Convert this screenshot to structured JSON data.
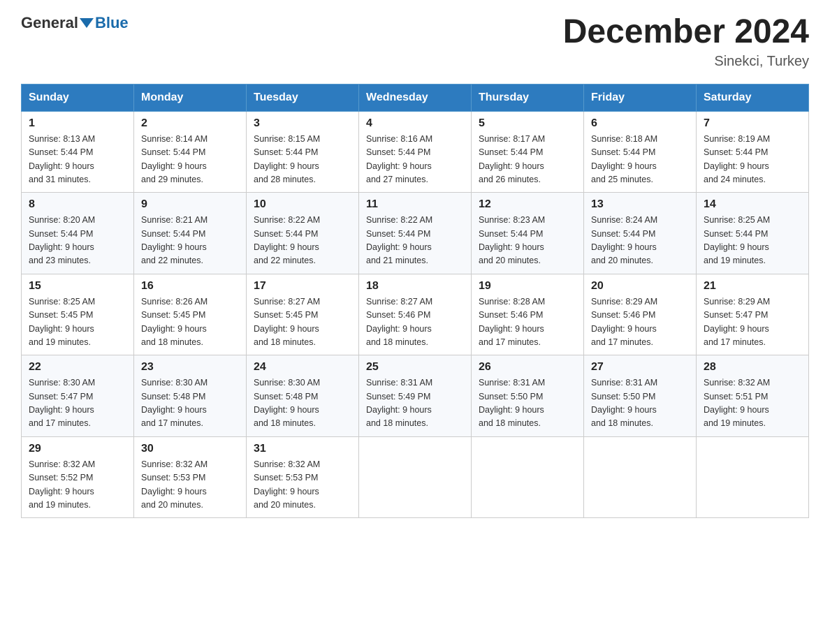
{
  "header": {
    "logo_general": "General",
    "logo_blue": "Blue",
    "month_year": "December 2024",
    "location": "Sinekci, Turkey"
  },
  "days_of_week": [
    "Sunday",
    "Monday",
    "Tuesday",
    "Wednesday",
    "Thursday",
    "Friday",
    "Saturday"
  ],
  "weeks": [
    [
      {
        "day": "1",
        "sunrise": "8:13 AM",
        "sunset": "5:44 PM",
        "daylight": "9 hours and 31 minutes."
      },
      {
        "day": "2",
        "sunrise": "8:14 AM",
        "sunset": "5:44 PM",
        "daylight": "9 hours and 29 minutes."
      },
      {
        "day": "3",
        "sunrise": "8:15 AM",
        "sunset": "5:44 PM",
        "daylight": "9 hours and 28 minutes."
      },
      {
        "day": "4",
        "sunrise": "8:16 AM",
        "sunset": "5:44 PM",
        "daylight": "9 hours and 27 minutes."
      },
      {
        "day": "5",
        "sunrise": "8:17 AM",
        "sunset": "5:44 PM",
        "daylight": "9 hours and 26 minutes."
      },
      {
        "day": "6",
        "sunrise": "8:18 AM",
        "sunset": "5:44 PM",
        "daylight": "9 hours and 25 minutes."
      },
      {
        "day": "7",
        "sunrise": "8:19 AM",
        "sunset": "5:44 PM",
        "daylight": "9 hours and 24 minutes."
      }
    ],
    [
      {
        "day": "8",
        "sunrise": "8:20 AM",
        "sunset": "5:44 PM",
        "daylight": "9 hours and 23 minutes."
      },
      {
        "day": "9",
        "sunrise": "8:21 AM",
        "sunset": "5:44 PM",
        "daylight": "9 hours and 22 minutes."
      },
      {
        "day": "10",
        "sunrise": "8:22 AM",
        "sunset": "5:44 PM",
        "daylight": "9 hours and 22 minutes."
      },
      {
        "day": "11",
        "sunrise": "8:22 AM",
        "sunset": "5:44 PM",
        "daylight": "9 hours and 21 minutes."
      },
      {
        "day": "12",
        "sunrise": "8:23 AM",
        "sunset": "5:44 PM",
        "daylight": "9 hours and 20 minutes."
      },
      {
        "day": "13",
        "sunrise": "8:24 AM",
        "sunset": "5:44 PM",
        "daylight": "9 hours and 20 minutes."
      },
      {
        "day": "14",
        "sunrise": "8:25 AM",
        "sunset": "5:44 PM",
        "daylight": "9 hours and 19 minutes."
      }
    ],
    [
      {
        "day": "15",
        "sunrise": "8:25 AM",
        "sunset": "5:45 PM",
        "daylight": "9 hours and 19 minutes."
      },
      {
        "day": "16",
        "sunrise": "8:26 AM",
        "sunset": "5:45 PM",
        "daylight": "9 hours and 18 minutes."
      },
      {
        "day": "17",
        "sunrise": "8:27 AM",
        "sunset": "5:45 PM",
        "daylight": "9 hours and 18 minutes."
      },
      {
        "day": "18",
        "sunrise": "8:27 AM",
        "sunset": "5:46 PM",
        "daylight": "9 hours and 18 minutes."
      },
      {
        "day": "19",
        "sunrise": "8:28 AM",
        "sunset": "5:46 PM",
        "daylight": "9 hours and 17 minutes."
      },
      {
        "day": "20",
        "sunrise": "8:29 AM",
        "sunset": "5:46 PM",
        "daylight": "9 hours and 17 minutes."
      },
      {
        "day": "21",
        "sunrise": "8:29 AM",
        "sunset": "5:47 PM",
        "daylight": "9 hours and 17 minutes."
      }
    ],
    [
      {
        "day": "22",
        "sunrise": "8:30 AM",
        "sunset": "5:47 PM",
        "daylight": "9 hours and 17 minutes."
      },
      {
        "day": "23",
        "sunrise": "8:30 AM",
        "sunset": "5:48 PM",
        "daylight": "9 hours and 17 minutes."
      },
      {
        "day": "24",
        "sunrise": "8:30 AM",
        "sunset": "5:48 PM",
        "daylight": "9 hours and 18 minutes."
      },
      {
        "day": "25",
        "sunrise": "8:31 AM",
        "sunset": "5:49 PM",
        "daylight": "9 hours and 18 minutes."
      },
      {
        "day": "26",
        "sunrise": "8:31 AM",
        "sunset": "5:50 PM",
        "daylight": "9 hours and 18 minutes."
      },
      {
        "day": "27",
        "sunrise": "8:31 AM",
        "sunset": "5:50 PM",
        "daylight": "9 hours and 18 minutes."
      },
      {
        "day": "28",
        "sunrise": "8:32 AM",
        "sunset": "5:51 PM",
        "daylight": "9 hours and 19 minutes."
      }
    ],
    [
      {
        "day": "29",
        "sunrise": "8:32 AM",
        "sunset": "5:52 PM",
        "daylight": "9 hours and 19 minutes."
      },
      {
        "day": "30",
        "sunrise": "8:32 AM",
        "sunset": "5:53 PM",
        "daylight": "9 hours and 20 minutes."
      },
      {
        "day": "31",
        "sunrise": "8:32 AM",
        "sunset": "5:53 PM",
        "daylight": "9 hours and 20 minutes."
      },
      null,
      null,
      null,
      null
    ]
  ]
}
